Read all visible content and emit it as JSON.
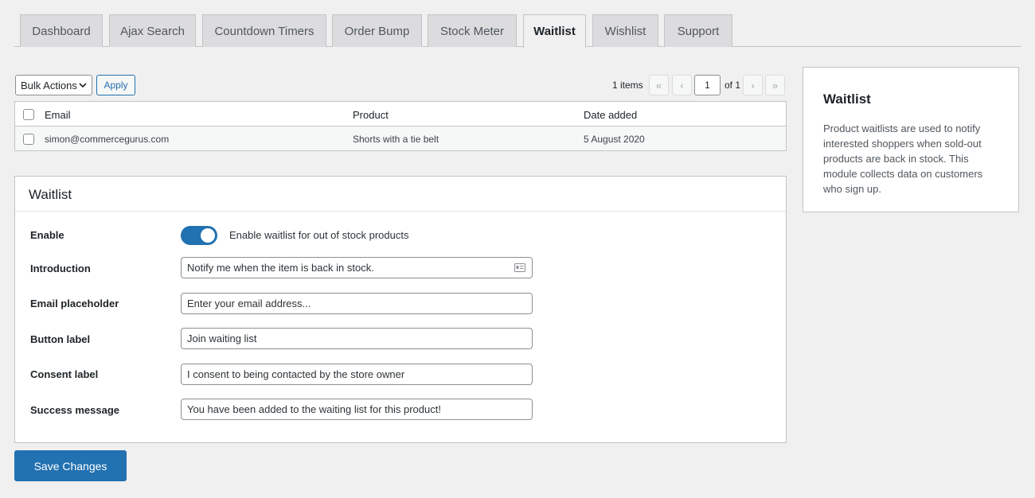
{
  "tabs": [
    {
      "label": "Dashboard"
    },
    {
      "label": "Ajax Search"
    },
    {
      "label": "Countdown Timers"
    },
    {
      "label": "Order Bump"
    },
    {
      "label": "Stock Meter"
    },
    {
      "label": "Waitlist",
      "active": true
    },
    {
      "label": "Wishlist"
    },
    {
      "label": "Support"
    }
  ],
  "bulk": {
    "select_value": "Bulk Actions",
    "apply_label": "Apply"
  },
  "pagination": {
    "items": "1 items",
    "first": "«",
    "prev": "‹",
    "current": "1",
    "of": "of 1",
    "next": "›",
    "last": "»"
  },
  "table": {
    "columns": [
      "Email",
      "Product",
      "Date added"
    ],
    "rows": [
      {
        "email": "simon@commercegurus.com",
        "product": "Shorts with a tie belt",
        "date": "5 August 2020"
      }
    ]
  },
  "settings": {
    "title": "Waitlist",
    "enable": {
      "label": "Enable",
      "toggle_text": "Enable waitlist for out of stock products",
      "on": true
    },
    "fields": [
      {
        "label": "Introduction",
        "value": "Notify me when the item is back in stock."
      },
      {
        "label": "Email placeholder",
        "value": "Enter your email address..."
      },
      {
        "label": "Button label",
        "value": "Join waiting list"
      },
      {
        "label": "Consent label",
        "value": "I consent to being contacted by the store owner"
      },
      {
        "label": "Success message",
        "value": "You have been added to the waiting list for this product!"
      }
    ],
    "save_label": "Save Changes"
  },
  "sidebar": {
    "title": "Waitlist",
    "text": "Product waitlists are used to notify interested shoppers when sold-out products are back in stock. This module collects data on customers who sign up."
  },
  "colors": {
    "primary": "#2271b1",
    "background": "#f0f0f1"
  }
}
